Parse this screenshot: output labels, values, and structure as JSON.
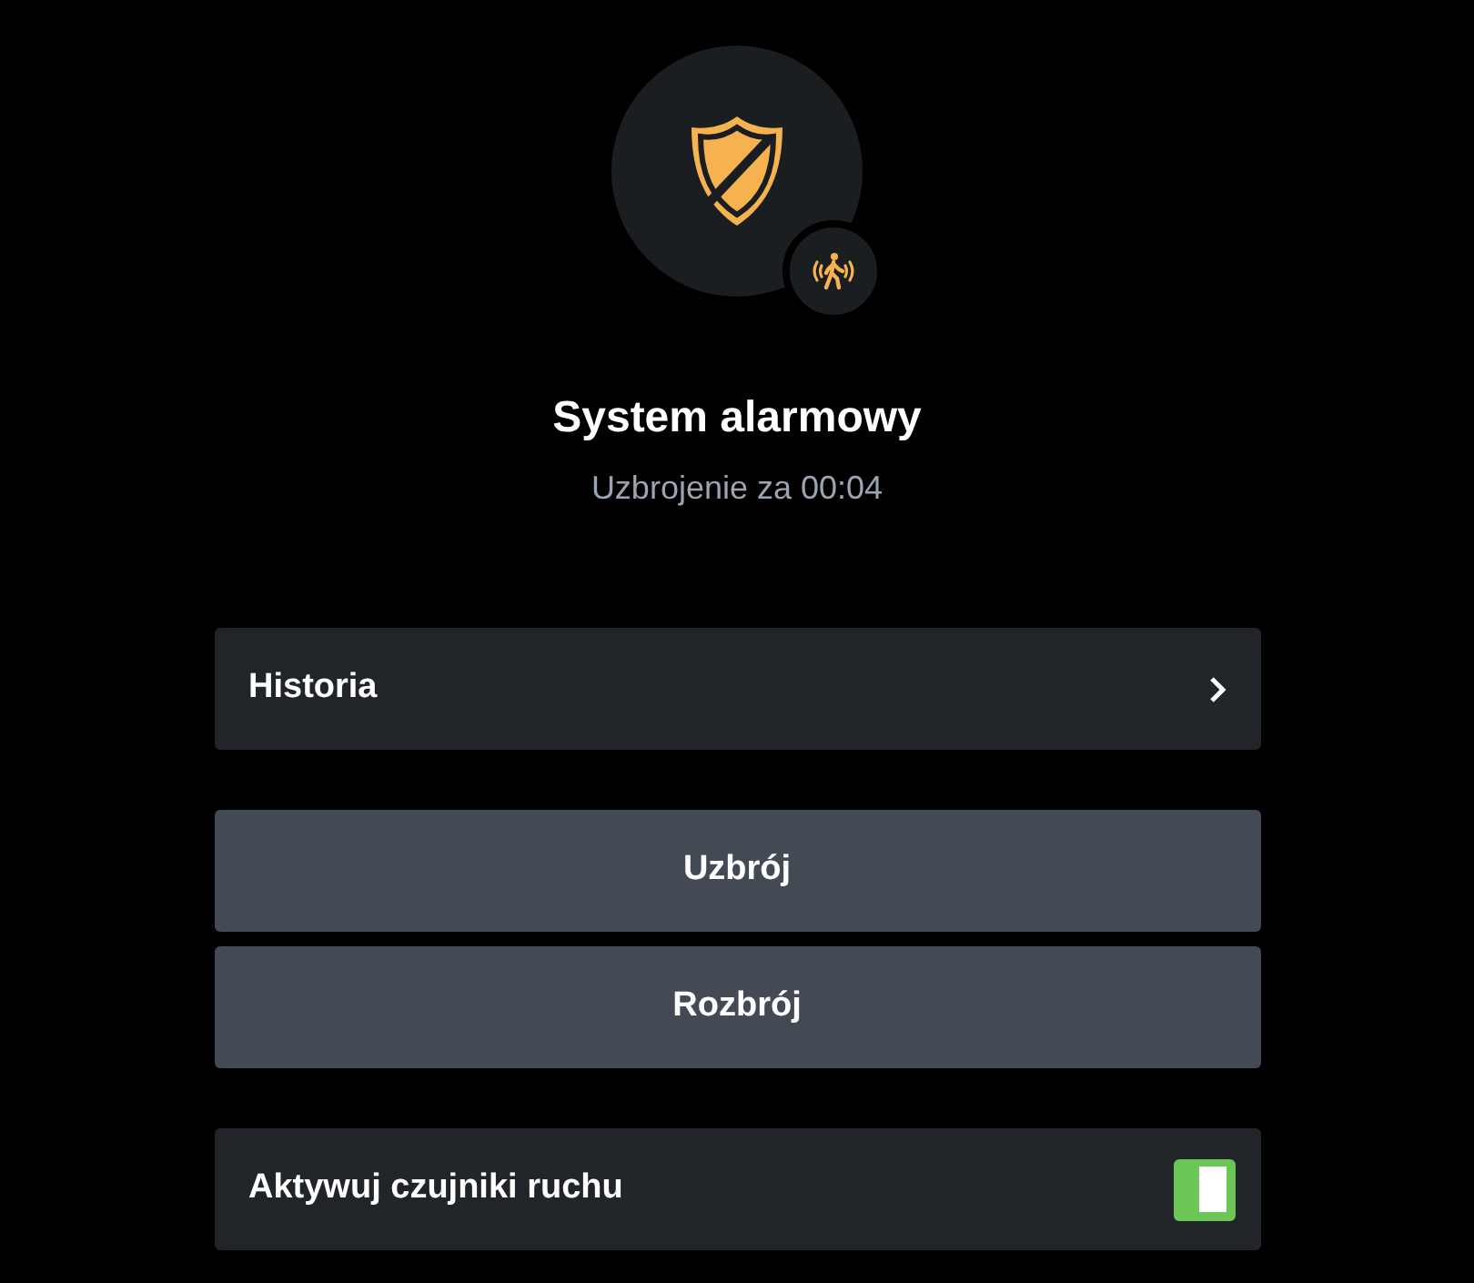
{
  "header": {
    "title": "System alarmowy",
    "status": "Uzbrojenie za 00:04"
  },
  "history": {
    "label": "Historia"
  },
  "buttons": [
    "Uzbrój",
    "Rozbrój"
  ],
  "motion_sensors": {
    "label": "Aktywuj czujniki ruchu",
    "on": true
  }
}
